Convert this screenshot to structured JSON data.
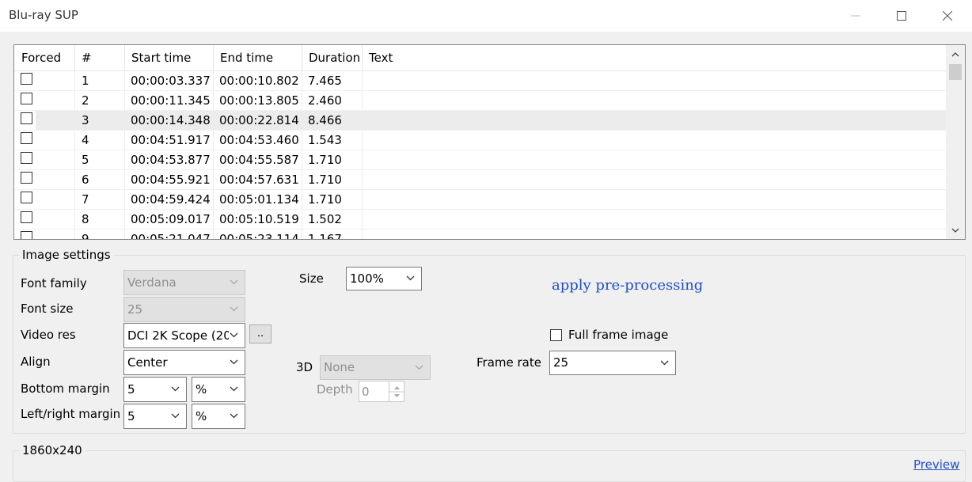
{
  "window": {
    "title": "Blu-ray SUP"
  },
  "table": {
    "columns": [
      "Forced",
      "#",
      "Start time",
      "End time",
      "Duration",
      "Text"
    ],
    "rows": [
      {
        "num": "1",
        "start": "00:00:03.337",
        "end": "00:00:10.802",
        "duration": "7.465",
        "text": ""
      },
      {
        "num": "2",
        "start": "00:00:11.345",
        "end": "00:00:13.805",
        "duration": "2.460",
        "text": ""
      },
      {
        "num": "3",
        "start": "00:00:14.348",
        "end": "00:00:22.814",
        "duration": "8.466",
        "text": ""
      },
      {
        "num": "4",
        "start": "00:04:51.917",
        "end": "00:04:53.460",
        "duration": "1.543",
        "text": ""
      },
      {
        "num": "5",
        "start": "00:04:53.877",
        "end": "00:04:55.587",
        "duration": "1.710",
        "text": ""
      },
      {
        "num": "6",
        "start": "00:04:55.921",
        "end": "00:04:57.631",
        "duration": "1.710",
        "text": ""
      },
      {
        "num": "7",
        "start": "00:04:59.424",
        "end": "00:05:01.134",
        "duration": "1.710",
        "text": ""
      },
      {
        "num": "8",
        "start": "00:05:09.017",
        "end": "00:05:10.519",
        "duration": "1.502",
        "text": ""
      },
      {
        "num": "9",
        "start": "00:05:21.047",
        "end": "00:05:23.114",
        "duration": "1.167",
        "text": ""
      }
    ]
  },
  "image_settings": {
    "group_label": "Image settings",
    "font_family_label": "Font family",
    "font_family_value": "Verdana",
    "font_size_label": "Font size",
    "font_size_value": "25",
    "video_res_label": "Video res",
    "video_res_value": "DCI 2K Scope (20",
    "video_res_more": "..",
    "align_label": "Align",
    "align_value": "Center",
    "bottom_margin_label": "Bottom margin",
    "bottom_margin_value": "5",
    "bottom_margin_unit": "%",
    "lr_margin_label": "Left/right margin",
    "lr_margin_value": "5",
    "lr_margin_unit": "%",
    "size_label": "Size",
    "size_value": "100%",
    "preprocess_link": "apply pre-processing",
    "threed_label": "3D",
    "threed_value": "None",
    "depth_label": "Depth",
    "depth_value": "0",
    "full_frame_label": "Full frame image",
    "frame_rate_label": "Frame rate",
    "frame_rate_value": "25"
  },
  "preview": {
    "group_label": "1860x240",
    "link": "Preview"
  }
}
